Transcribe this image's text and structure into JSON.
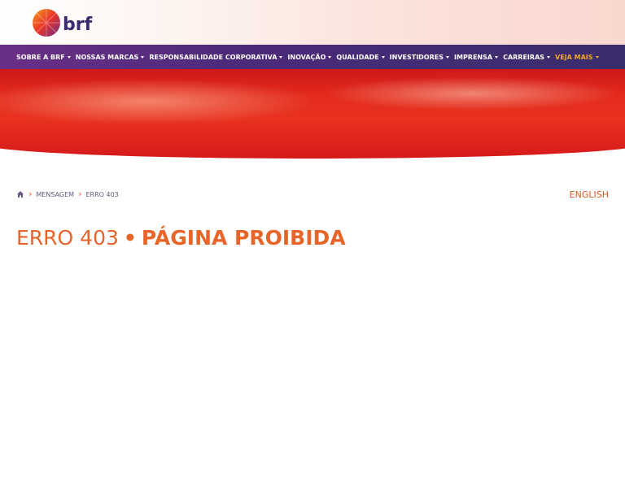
{
  "brand": {
    "logo_text": "brf",
    "accent": "#e2571f",
    "nav_bg": "#4b2a7a",
    "highlight": "#f5a623"
  },
  "nav": {
    "items": [
      {
        "label": "SOBRE A BRF",
        "highlight": false
      },
      {
        "label": "NOSSAS MARCAS",
        "highlight": false
      },
      {
        "label": "RESPONSABILIDADE CORPORATIVA",
        "highlight": false
      },
      {
        "label": "INOVAÇÃO",
        "highlight": false
      },
      {
        "label": "QUALIDADE",
        "highlight": false
      },
      {
        "label": "INVESTIDORES",
        "highlight": false
      },
      {
        "label": "IMPRENSA",
        "highlight": false
      },
      {
        "label": "CARREIRAS",
        "highlight": false
      },
      {
        "label": "VEJA MAIS",
        "highlight": true
      }
    ]
  },
  "breadcrumb": {
    "items": [
      "MENSAGEM",
      "ERRO 403"
    ],
    "home_icon": "home-icon"
  },
  "language_link": "ENGLISH",
  "page_title": {
    "code": "ERRO 403",
    "separator": "•",
    "message": "PÁGINA PROIBIDA"
  }
}
